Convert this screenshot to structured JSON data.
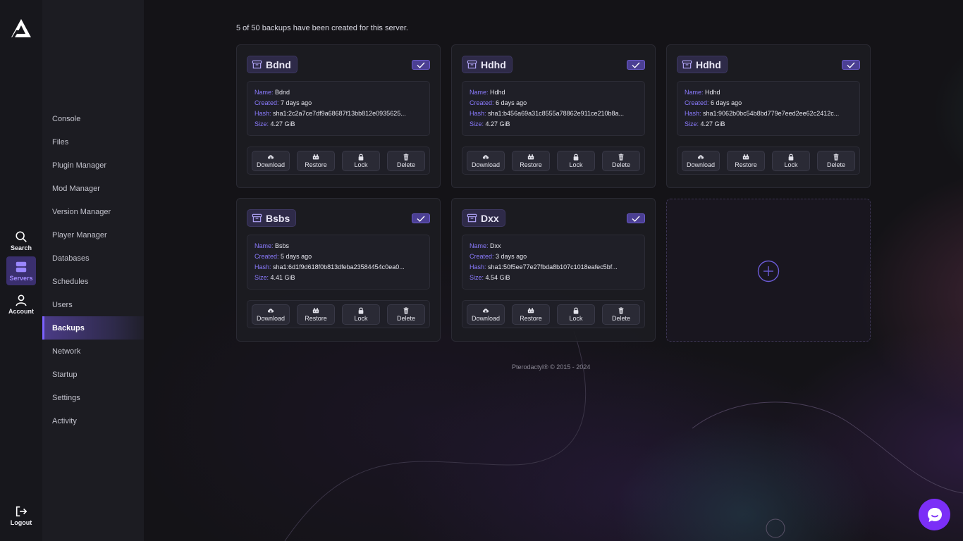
{
  "rail": {
    "items": [
      {
        "label": "Search",
        "icon": "search-icon"
      },
      {
        "label": "Servers",
        "icon": "servers-icon",
        "active": true
      },
      {
        "label": "Account",
        "icon": "account-icon"
      },
      {
        "label": "Logout",
        "icon": "logout-icon"
      }
    ]
  },
  "nav": {
    "items": [
      {
        "label": "Console"
      },
      {
        "label": "Files"
      },
      {
        "label": "Plugin Manager"
      },
      {
        "label": "Mod Manager"
      },
      {
        "label": "Version Manager"
      },
      {
        "label": "Player Manager"
      },
      {
        "label": "Databases"
      },
      {
        "label": "Schedules"
      },
      {
        "label": "Users"
      },
      {
        "label": "Backups",
        "active": true
      },
      {
        "label": "Network"
      },
      {
        "label": "Startup"
      },
      {
        "label": "Settings"
      },
      {
        "label": "Activity"
      }
    ]
  },
  "summary": "5 of 50 backups have been created for this server.",
  "labels": {
    "name": "Name:",
    "created": "Created:",
    "hash": "Hash:",
    "size": "Size:"
  },
  "buttons": {
    "download": "Download",
    "restore": "Restore",
    "lock": "Lock",
    "delete": "Delete"
  },
  "backups": [
    {
      "title": "Bdnd",
      "name": "Bdnd",
      "created": "7 days ago",
      "hash": "sha1:2c2a7ce7df9a68687f13bb812e0935625...",
      "size": "4.27 GiB",
      "checked": true
    },
    {
      "title": "Hdhd",
      "name": "Hdhd",
      "created": "6 days ago",
      "hash": "sha1:b456a69a31c8555a78862e911ce210b8a...",
      "size": "4.27 GiB",
      "checked": true
    },
    {
      "title": "Hdhd",
      "name": "Hdhd",
      "created": "6 days ago",
      "hash": "sha1:9062b0bc54b8bd779e7eed2ee62c2412c...",
      "size": "4.27 GiB",
      "checked": true
    },
    {
      "title": "Bsbs",
      "name": "Bsbs",
      "created": "5 days ago",
      "hash": "sha1:6d1f9d618f0b813dfeba23584454c0ea0...",
      "size": "4.41 GiB",
      "checked": true
    },
    {
      "title": "Dxx",
      "name": "Dxx",
      "created": "3 days ago",
      "hash": "sha1:50f5ee77e27fbda8b107c1018eafec5bf...",
      "size": "4.54 GiB",
      "checked": true
    }
  ],
  "footer": "Pterodactyl® © 2015 - 2024",
  "colors": {
    "accent": "#7b61ff",
    "chat": "#7b2ff7",
    "label": "#8b7bff"
  }
}
